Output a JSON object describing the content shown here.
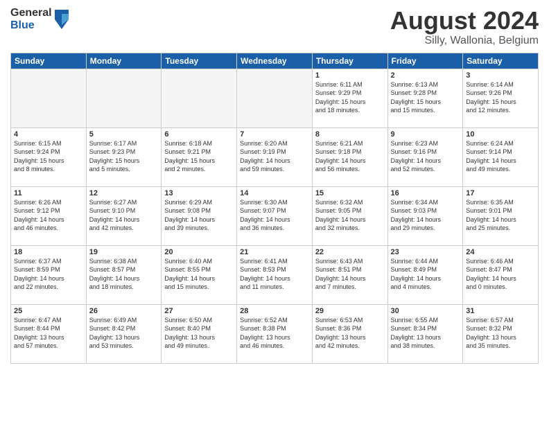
{
  "header": {
    "logo_general": "General",
    "logo_blue": "Blue",
    "title": "August 2024",
    "subtitle": "Silly, Wallonia, Belgium"
  },
  "days_of_week": [
    "Sunday",
    "Monday",
    "Tuesday",
    "Wednesday",
    "Thursday",
    "Friday",
    "Saturday"
  ],
  "weeks": [
    [
      {
        "day": "",
        "info": ""
      },
      {
        "day": "",
        "info": ""
      },
      {
        "day": "",
        "info": ""
      },
      {
        "day": "",
        "info": ""
      },
      {
        "day": "1",
        "info": "Sunrise: 6:11 AM\nSunset: 9:29 PM\nDaylight: 15 hours\nand 18 minutes."
      },
      {
        "day": "2",
        "info": "Sunrise: 6:13 AM\nSunset: 9:28 PM\nDaylight: 15 hours\nand 15 minutes."
      },
      {
        "day": "3",
        "info": "Sunrise: 6:14 AM\nSunset: 9:26 PM\nDaylight: 15 hours\nand 12 minutes."
      }
    ],
    [
      {
        "day": "4",
        "info": "Sunrise: 6:15 AM\nSunset: 9:24 PM\nDaylight: 15 hours\nand 8 minutes."
      },
      {
        "day": "5",
        "info": "Sunrise: 6:17 AM\nSunset: 9:23 PM\nDaylight: 15 hours\nand 5 minutes."
      },
      {
        "day": "6",
        "info": "Sunrise: 6:18 AM\nSunset: 9:21 PM\nDaylight: 15 hours\nand 2 minutes."
      },
      {
        "day": "7",
        "info": "Sunrise: 6:20 AM\nSunset: 9:19 PM\nDaylight: 14 hours\nand 59 minutes."
      },
      {
        "day": "8",
        "info": "Sunrise: 6:21 AM\nSunset: 9:18 PM\nDaylight: 14 hours\nand 56 minutes."
      },
      {
        "day": "9",
        "info": "Sunrise: 6:23 AM\nSunset: 9:16 PM\nDaylight: 14 hours\nand 52 minutes."
      },
      {
        "day": "10",
        "info": "Sunrise: 6:24 AM\nSunset: 9:14 PM\nDaylight: 14 hours\nand 49 minutes."
      }
    ],
    [
      {
        "day": "11",
        "info": "Sunrise: 6:26 AM\nSunset: 9:12 PM\nDaylight: 14 hours\nand 46 minutes."
      },
      {
        "day": "12",
        "info": "Sunrise: 6:27 AM\nSunset: 9:10 PM\nDaylight: 14 hours\nand 42 minutes."
      },
      {
        "day": "13",
        "info": "Sunrise: 6:29 AM\nSunset: 9:08 PM\nDaylight: 14 hours\nand 39 minutes."
      },
      {
        "day": "14",
        "info": "Sunrise: 6:30 AM\nSunset: 9:07 PM\nDaylight: 14 hours\nand 36 minutes."
      },
      {
        "day": "15",
        "info": "Sunrise: 6:32 AM\nSunset: 9:05 PM\nDaylight: 14 hours\nand 32 minutes."
      },
      {
        "day": "16",
        "info": "Sunrise: 6:34 AM\nSunset: 9:03 PM\nDaylight: 14 hours\nand 29 minutes."
      },
      {
        "day": "17",
        "info": "Sunrise: 6:35 AM\nSunset: 9:01 PM\nDaylight: 14 hours\nand 25 minutes."
      }
    ],
    [
      {
        "day": "18",
        "info": "Sunrise: 6:37 AM\nSunset: 8:59 PM\nDaylight: 14 hours\nand 22 minutes."
      },
      {
        "day": "19",
        "info": "Sunrise: 6:38 AM\nSunset: 8:57 PM\nDaylight: 14 hours\nand 18 minutes."
      },
      {
        "day": "20",
        "info": "Sunrise: 6:40 AM\nSunset: 8:55 PM\nDaylight: 14 hours\nand 15 minutes."
      },
      {
        "day": "21",
        "info": "Sunrise: 6:41 AM\nSunset: 8:53 PM\nDaylight: 14 hours\nand 11 minutes."
      },
      {
        "day": "22",
        "info": "Sunrise: 6:43 AM\nSunset: 8:51 PM\nDaylight: 14 hours\nand 7 minutes."
      },
      {
        "day": "23",
        "info": "Sunrise: 6:44 AM\nSunset: 8:49 PM\nDaylight: 14 hours\nand 4 minutes."
      },
      {
        "day": "24",
        "info": "Sunrise: 6:46 AM\nSunset: 8:47 PM\nDaylight: 14 hours\nand 0 minutes."
      }
    ],
    [
      {
        "day": "25",
        "info": "Sunrise: 6:47 AM\nSunset: 8:44 PM\nDaylight: 13 hours\nand 57 minutes."
      },
      {
        "day": "26",
        "info": "Sunrise: 6:49 AM\nSunset: 8:42 PM\nDaylight: 13 hours\nand 53 minutes."
      },
      {
        "day": "27",
        "info": "Sunrise: 6:50 AM\nSunset: 8:40 PM\nDaylight: 13 hours\nand 49 minutes."
      },
      {
        "day": "28",
        "info": "Sunrise: 6:52 AM\nSunset: 8:38 PM\nDaylight: 13 hours\nand 46 minutes."
      },
      {
        "day": "29",
        "info": "Sunrise: 6:53 AM\nSunset: 8:36 PM\nDaylight: 13 hours\nand 42 minutes."
      },
      {
        "day": "30",
        "info": "Sunrise: 6:55 AM\nSunset: 8:34 PM\nDaylight: 13 hours\nand 38 minutes."
      },
      {
        "day": "31",
        "info": "Sunrise: 6:57 AM\nSunset: 8:32 PM\nDaylight: 13 hours\nand 35 minutes."
      }
    ]
  ]
}
